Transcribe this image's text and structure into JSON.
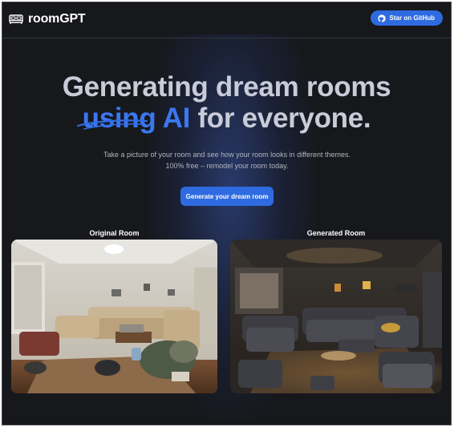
{
  "header": {
    "app_name": "roomGPT",
    "github_button_label": "Star on GitHub"
  },
  "hero": {
    "title_line1": "Generating dream rooms",
    "title_accent": "using AI",
    "title_line2_rest": "for everyone.",
    "subtitle": "Take a picture of your room and see how your room looks in different themes. 100% free – remodel your room today.",
    "cta_label": "Generate your dream room"
  },
  "comparison": {
    "original_label": "Original Room",
    "generated_label": "Generated Room"
  },
  "colors": {
    "background": "#17181c",
    "accent": "#2f6be0",
    "title": "#c8ccd8"
  }
}
